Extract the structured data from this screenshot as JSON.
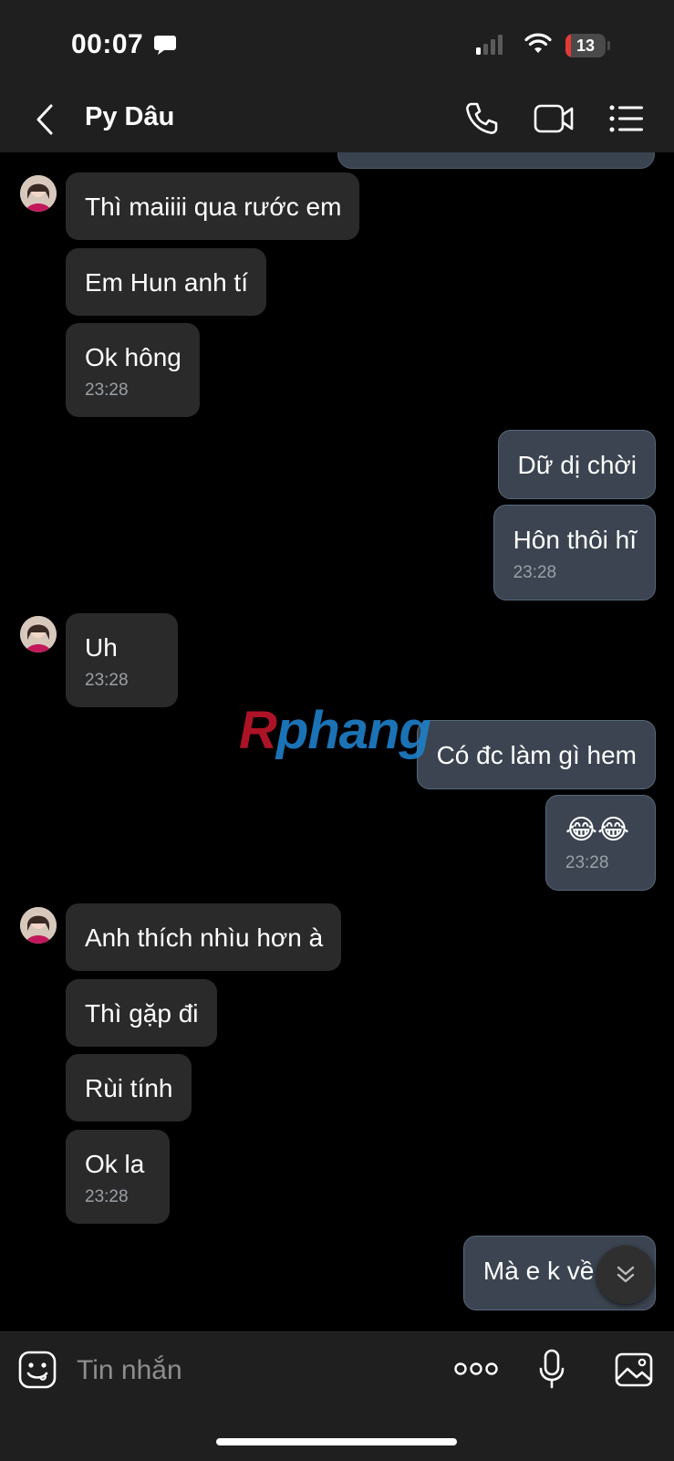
{
  "status_bar": {
    "time": "00:07",
    "battery_level": 13,
    "battery_label": "13",
    "battery_color": "#e53935",
    "signal_bars": 1
  },
  "header": {
    "contact_name": "Py Dâu",
    "back_icon": "chevron-left",
    "call_icon": "phone",
    "video_icon": "video-camera",
    "menu_icon": "list-menu"
  },
  "messages": [
    {
      "dir": "in",
      "text": "Thì maiiii qua rước em",
      "time": ""
    },
    {
      "dir": "in",
      "text": "Em Hun anh tí",
      "time": ""
    },
    {
      "dir": "in",
      "text": "Ok hông",
      "time": "23:28"
    },
    {
      "dir": "out",
      "text": "Dữ dị chời",
      "time": ""
    },
    {
      "dir": "out",
      "text": "Hôn thôi hĩ",
      "time": "23:28"
    },
    {
      "dir": "in",
      "text": "Uh",
      "time": "23:28"
    },
    {
      "dir": "out",
      "text": "Có đc làm gì hem",
      "time": ""
    },
    {
      "dir": "out",
      "text": "😂😂",
      "time": "23:28"
    },
    {
      "dir": "in",
      "text": "Anh thích nhìu hơn à",
      "time": ""
    },
    {
      "dir": "in",
      "text": "Thì gặp đi",
      "time": ""
    },
    {
      "dir": "in",
      "text": "Rùi tính",
      "time": ""
    },
    {
      "dir": "in",
      "text": "Ok la",
      "time": "23:28"
    },
    {
      "dir": "out",
      "text": "Mà e k về q...",
      "time": ""
    }
  ],
  "watermark": {
    "prefix": "R",
    "rest": "phang"
  },
  "composer": {
    "placeholder": "Tin nhắn",
    "sticker_icon": "sticker-smile",
    "more_icon": "ellipsis",
    "mic_icon": "microphone",
    "image_icon": "image"
  },
  "colors": {
    "incoming_bubble": "#2a2a2a",
    "outgoing_bubble": "#3b4450",
    "bar_background": "#1f1f1f"
  }
}
